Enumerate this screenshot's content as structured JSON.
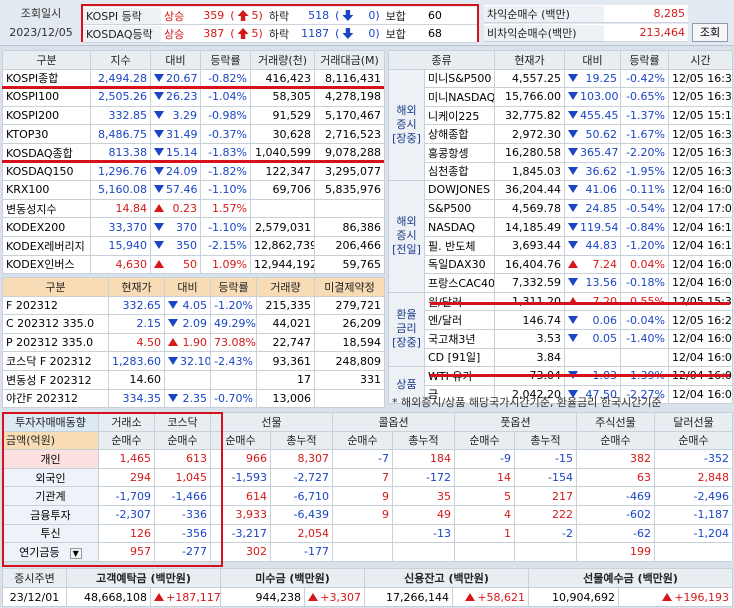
{
  "top": {
    "label_date": "조회일시",
    "date": "2023/12/05",
    "kospi": {
      "name": "KOSPI 등락",
      "up_lbl": "상승",
      "up": "359",
      "up_n": "5",
      "dn_lbl": "하락",
      "dn": "518",
      "dn_n": "0",
      "flat_lbl": "보합",
      "flat": "60"
    },
    "kosdaq": {
      "name": "KOSDAQ등락",
      "up_lbl": "상승",
      "up": "387",
      "up_n": "5",
      "dn_lbl": "하락",
      "dn": "1187",
      "dn_n": "0",
      "flat_lbl": "보합",
      "flat": "68"
    },
    "arb_lbl": "차익순매수 (백만)",
    "arb": "8,285",
    "nonarb_lbl": "비차익순매수(백만)",
    "nonarb": "213,464",
    "query_btn": "조회"
  },
  "index_table": {
    "headers": [
      "구분",
      "지수",
      "대비",
      "등락률",
      "거래량(천)",
      "거래대금(M)"
    ],
    "rows": [
      [
        "KOSPI종합",
        "2,494.28",
        "dn",
        "20.67",
        "-0.82%",
        "416,423",
        "8,116,431"
      ],
      [
        "KOSPI100",
        "2,505.26",
        "dn",
        "26.23",
        "-1.04%",
        "58,305",
        "4,278,198"
      ],
      [
        "KOSPI200",
        "332.85",
        "dn",
        "3.29",
        "-0.98%",
        "91,529",
        "5,170,467"
      ],
      [
        "KTOP30",
        "8,486.75",
        "dn",
        "31.49",
        "-0.37%",
        "30,628",
        "2,716,523"
      ],
      [
        "KOSDAQ종합",
        "813.38",
        "dn",
        "15.14",
        "-1.83%",
        "1,040,599",
        "9,078,288"
      ],
      [
        "KOSDAQ150",
        "1,296.76",
        "dn",
        "24.09",
        "-1.82%",
        "122,347",
        "3,295,077"
      ],
      [
        "KRX100",
        "5,160.08",
        "dn",
        "57.46",
        "-1.10%",
        "69,706",
        "5,835,976"
      ],
      [
        "변동성지수",
        "14.84",
        "up",
        "0.23",
        "1.57%",
        "",
        ""
      ],
      [
        "KODEX200",
        "33,370",
        "dn",
        "370",
        "-1.10%",
        "2,579,031",
        "86,386"
      ],
      [
        "KODEX레버리지",
        "15,940",
        "dn",
        "350",
        "-2.15%",
        "12,862,739",
        "206,466"
      ],
      [
        "KODEX인버스",
        "4,630",
        "up",
        "50",
        "1.09%",
        "12,944,192",
        "59,765"
      ]
    ]
  },
  "futures_table": {
    "headers": [
      "구분",
      "현재가",
      "대비",
      "등락률",
      "거래량",
      "미결제약정"
    ],
    "rows": [
      [
        "F 202312",
        "332.65",
        "dn",
        "4.05",
        "-1.20%",
        "215,335",
        "279,721"
      ],
      [
        "C 202312 335.0",
        "2.15",
        "dn",
        "2.09",
        "49.29%",
        "44,021",
        "26,209"
      ],
      [
        "P 202312 335.0",
        "4.50",
        "up",
        "1.90",
        "73.08%",
        "22,747",
        "18,594"
      ],
      [
        "코스닥 F 202312",
        "1,283.60",
        "dn",
        "32.10",
        "-2.43%",
        "93,361",
        "248,809"
      ],
      [
        "변동성 F 202312",
        "14.60",
        "",
        "",
        "",
        "17",
        "331"
      ],
      [
        "야간F 202312",
        "334.35",
        "dn",
        "2.35",
        "-0.70%",
        "13,006",
        ""
      ]
    ]
  },
  "world_table": {
    "headers": [
      "종류",
      "현재가",
      "대비",
      "등락률",
      "시간"
    ],
    "groups": [
      {
        "label": "해외증시[장중]",
        "rows": [
          [
            "미니S&P500",
            "4,557.25",
            "dn",
            "19.25",
            "-0.42%",
            "12/05",
            "16:30"
          ],
          [
            "미니NASDAQ",
            "15,766.00",
            "dn",
            "103.00",
            "-0.65%",
            "12/05",
            "16:30"
          ],
          [
            "니케이225",
            "32,775.82",
            "dn",
            "455.45",
            "-1.37%",
            "12/05",
            "15:15"
          ],
          [
            "상해종합",
            "2,972.30",
            "dn",
            "50.62",
            "-1.67%",
            "12/05",
            "16:30"
          ],
          [
            "홍콩항셍",
            "16,280.58",
            "dn",
            "365.47",
            "-2.20%",
            "12/05",
            "16:30"
          ],
          [
            "심천종합",
            "1,845.03",
            "dn",
            "36.62",
            "-1.95%",
            "12/05",
            "16:30"
          ]
        ]
      },
      {
        "label": "해외증시[전일]",
        "rows": [
          [
            "DOWJONES",
            "36,204.44",
            "dn",
            "41.06",
            "-0.11%",
            "12/04",
            "16:00"
          ],
          [
            "S&P500",
            "4,569.78",
            "dn",
            "24.85",
            "-0.54%",
            "12/04",
            "17:03"
          ],
          [
            "NASDAQ",
            "14,185.49",
            "dn",
            "119.54",
            "-0.84%",
            "12/04",
            "16:15"
          ],
          [
            "필. 반도체",
            "3,693.44",
            "dn",
            "44.83",
            "-1.20%",
            "12/04",
            "16:15"
          ],
          [
            "독일DAX30",
            "16,404.76",
            "up",
            "7.24",
            "0.04%",
            "12/04",
            "16:00"
          ],
          [
            "프랑스CAC40",
            "7,332.59",
            "dn",
            "13.56",
            "-0.18%",
            "12/04",
            "16:00"
          ]
        ]
      },
      {
        "label": "환율금리[장중]",
        "rows": [
          [
            "원/달러",
            "1,311.20",
            "up",
            "7.20",
            "0.55%",
            "12/05",
            "15:30"
          ],
          [
            "엔/달러",
            "146.74",
            "dn",
            "0.06",
            "-0.04%",
            "12/05",
            "16:29"
          ],
          [
            "국고채3년",
            "3.53",
            "dn",
            "0.05",
            "-1.40%",
            "12/04",
            "16:00"
          ],
          [
            "CD [91일]",
            "3.84",
            "",
            "",
            "",
            "12/04",
            "16:00"
          ]
        ]
      },
      {
        "label": "상품",
        "rows": [
          [
            "WTI 유가",
            "73.04",
            "dn",
            "1.03",
            "-1.39%",
            "12/04",
            "16:00"
          ],
          [
            "금",
            "2,042.20",
            "dn",
            "47.50",
            "-2.27%",
            "12/04",
            "16:00"
          ]
        ]
      }
    ],
    "note": "* 해외증시/상품 해당국가시간기준, 환율금리 한국시간기준"
  },
  "investor_table": {
    "title": "투자자매매동향",
    "unit": "금액(억원)",
    "col_groups": [
      "거래소",
      "코스닥",
      "선물",
      "콜옵션",
      "풋옵션",
      "주식선물",
      "달러선물"
    ],
    "sub_headers": [
      "순매수",
      "순매수",
      "순매수",
      "총누적",
      "순매수",
      "총누적",
      "순매수",
      "총누적",
      "순매수",
      "순매수"
    ],
    "rows": [
      [
        "개인",
        "1,465",
        "613",
        "966",
        "8,307",
        "-7",
        "184",
        "-9",
        "-15",
        "382",
        "-352"
      ],
      [
        "외국인",
        "294",
        "1,045",
        "-1,593",
        "-2,727",
        "7",
        "-172",
        "14",
        "-154",
        "63",
        "2,848"
      ],
      [
        "기관계",
        "-1,709",
        "-1,466",
        "614",
        "-6,710",
        "9",
        "35",
        "5",
        "217",
        "-469",
        "-2,496"
      ],
      [
        "금융투자",
        "-2,307",
        "-336",
        "3,933",
        "-6,439",
        "9",
        "49",
        "4",
        "222",
        "-602",
        "-1,187"
      ],
      [
        "투신",
        "126",
        "-356",
        "-3,217",
        "2,054",
        "",
        "-13",
        "1",
        "-2",
        "-62",
        "-1,204"
      ],
      [
        "연기금등",
        "957",
        "-277",
        "302",
        "-177",
        "",
        "",
        "",
        "",
        "199",
        ""
      ]
    ]
  },
  "footer": {
    "headers": [
      "증시주변",
      "고객예탁금 (백만원)",
      "미수금 (백만원)",
      "신용잔고 (백만원)",
      "선물예수금 (백만원)"
    ],
    "date": "23/12/01",
    "deposit": "48,668,108",
    "deposit_chg": "+187,117",
    "receivable": "944,238",
    "receivable_chg": "+3,307",
    "credit": "17,266,144",
    "credit_chg": "+58,621",
    "futures_dep": "10,904,692",
    "futures_dep_chg": "+196,193"
  }
}
